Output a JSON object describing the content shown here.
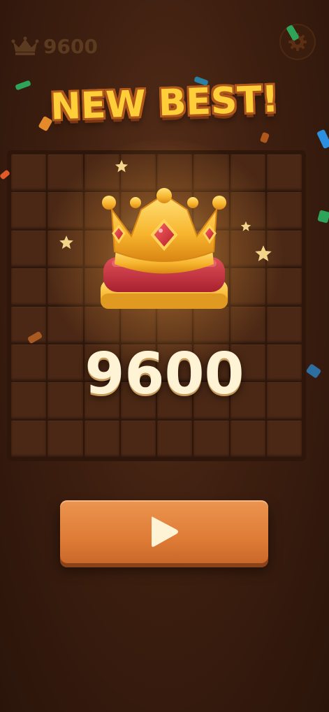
{
  "header": {
    "best_score": "9600",
    "best_icon": "crown-icon",
    "settings_icon": "gear-icon"
  },
  "banner": {
    "title": "NEW BEST!"
  },
  "result": {
    "score": "9600",
    "art_icon": "crown-on-cushion-icon"
  },
  "actions": {
    "play_icon": "play-icon"
  },
  "colors": {
    "background": "#3e1f10",
    "title_fill": "#ffcf3a",
    "title_outline": "#b0581c",
    "button": "#df7c36",
    "score_text": "#fff3d6"
  }
}
